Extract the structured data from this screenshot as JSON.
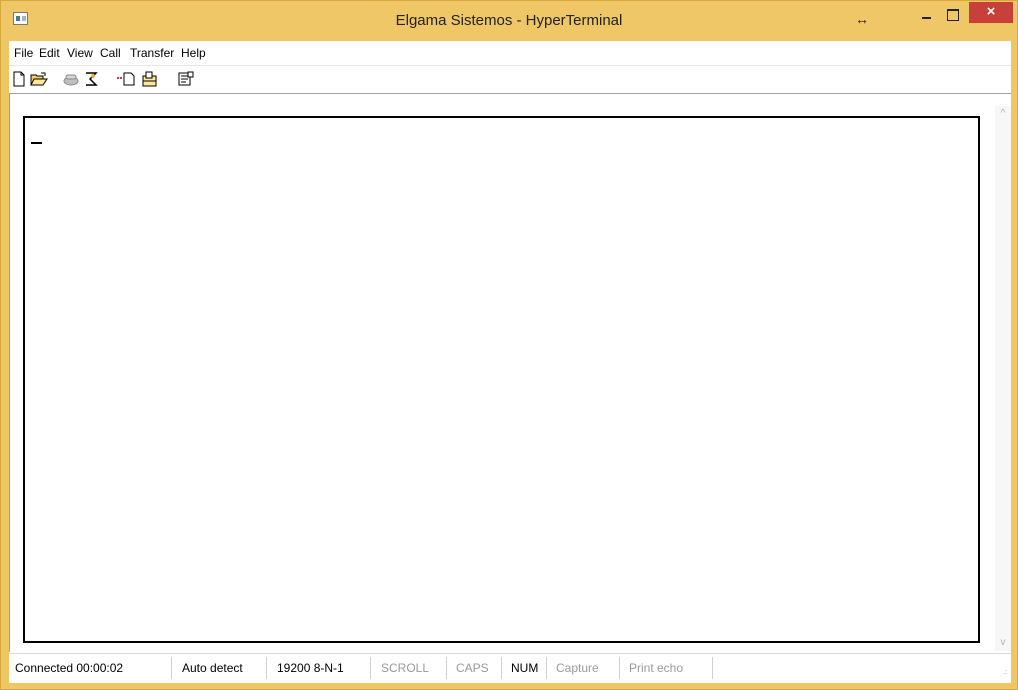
{
  "window": {
    "title": "Elgama Sistemos - HyperTerminal",
    "resize_glyph": "↔",
    "close_label": "×"
  },
  "menubar": {
    "items": [
      "File",
      "Edit",
      "View",
      "Call",
      "Transfer",
      "Help"
    ]
  },
  "toolbar": {
    "buttons": [
      {
        "name": "new-connection",
        "icon": "new-document-icon"
      },
      {
        "name": "open",
        "icon": "open-folder-icon"
      },
      {
        "name": "connect",
        "icon": "phone-icon"
      },
      {
        "name": "disconnect",
        "icon": "hangup-phone-icon"
      },
      {
        "name": "send",
        "icon": "send-file-icon"
      },
      {
        "name": "receive",
        "icon": "receive-file-icon"
      },
      {
        "name": "properties",
        "icon": "properties-icon"
      }
    ]
  },
  "terminal": {
    "cursor_char": "_"
  },
  "statusbar": {
    "connected": "Connected 00:00:02",
    "detect": "Auto detect",
    "port_settings": "19200 8-N-1",
    "scroll": "SCROLL",
    "caps": "CAPS",
    "num": "NUM",
    "capture": "Capture",
    "print_echo": "Print echo"
  },
  "colors": {
    "frame": "#efc664",
    "close_button": "#c7413a",
    "dim_status": "#9a9a9a"
  }
}
